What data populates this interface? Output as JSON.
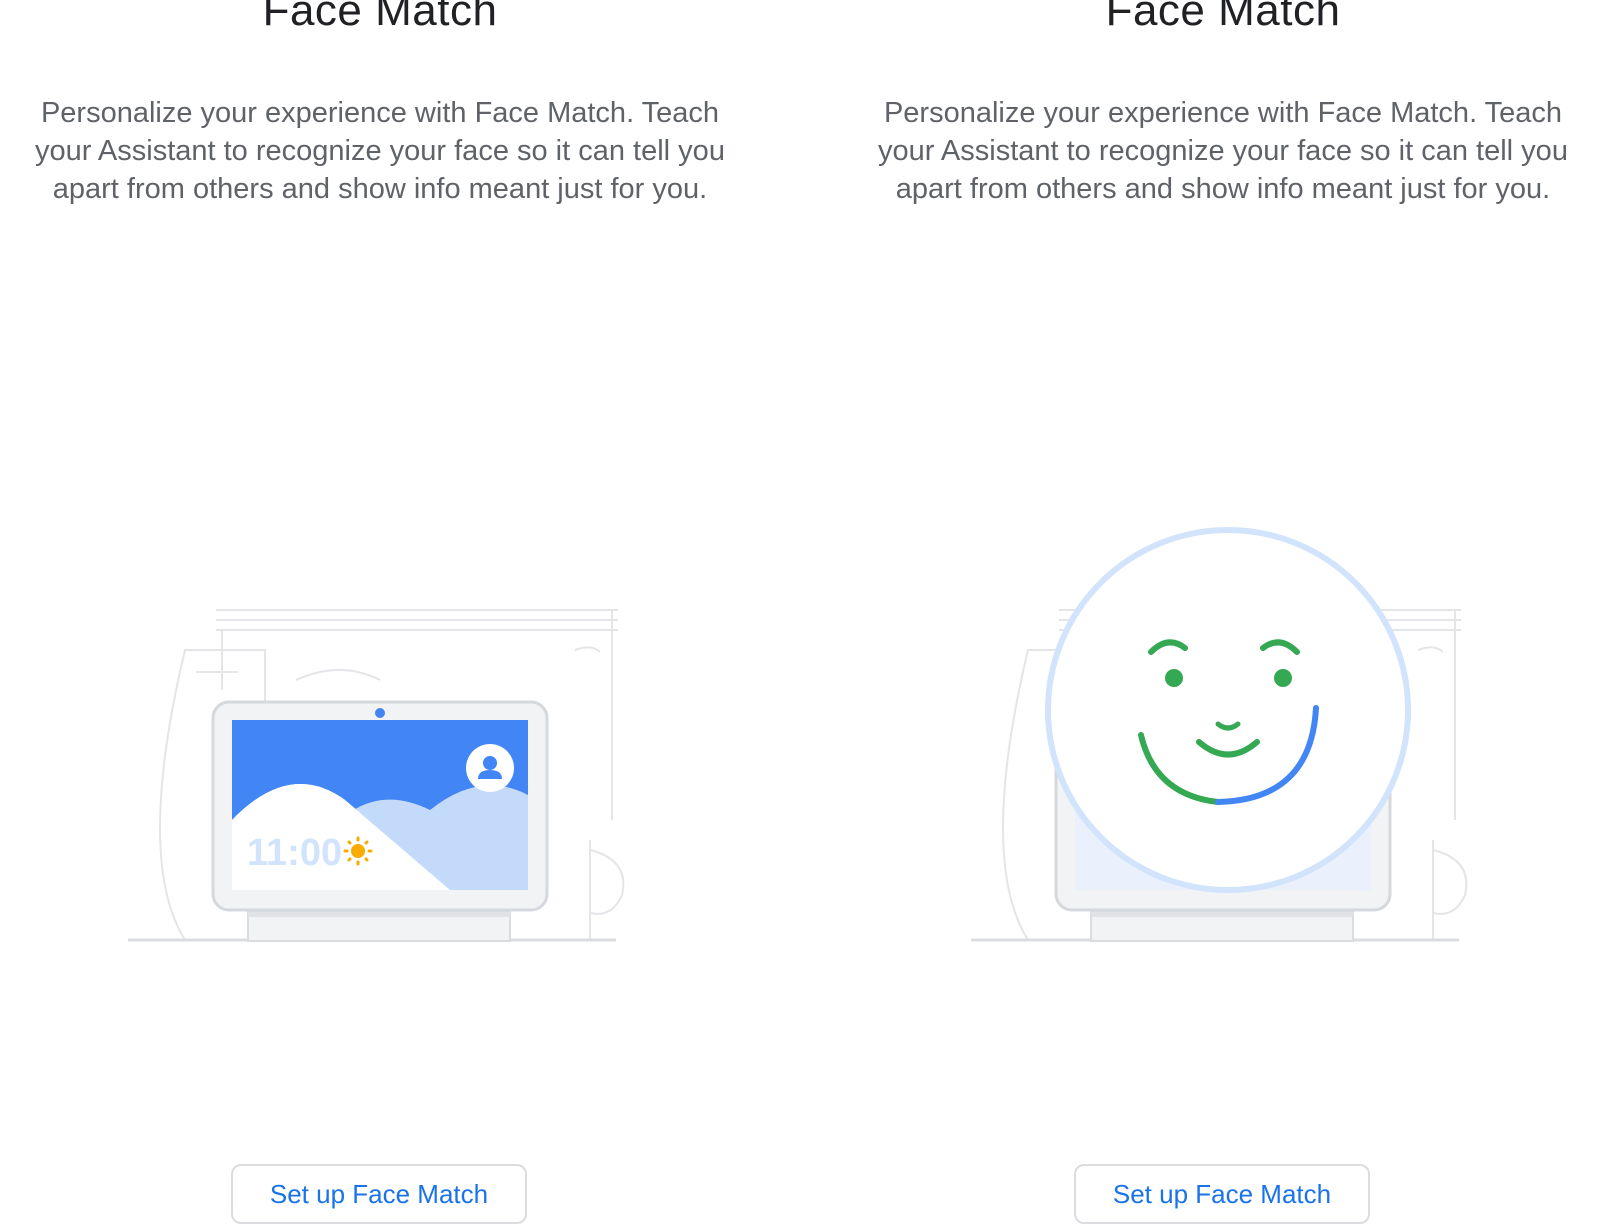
{
  "panels": [
    {
      "title": "Face Match",
      "description": "Personalize your experience with Face Match. Teach your Assistant to recognize your face so it can tell you apart from others and show info meant just for you.",
      "display_time": "11:00",
      "button_label": "Set up Face Match"
    },
    {
      "title": "Face Match",
      "description": "Personalize your experience with Face Match. Teach your Assistant to recognize your face so it can tell you apart from others and show info meant just for you.",
      "button_label": "Set up Face Match"
    }
  ],
  "colors": {
    "brand_blue": "#4285f4",
    "brand_green": "#34a853",
    "sun_yellow": "#f9ab00",
    "button_text": "#1a73e8",
    "body_text": "#5f6368",
    "title_text": "#202124"
  },
  "icons": {
    "avatar": "person-avatar-icon",
    "weather": "sun-icon",
    "face": "smiley-face-icon"
  }
}
